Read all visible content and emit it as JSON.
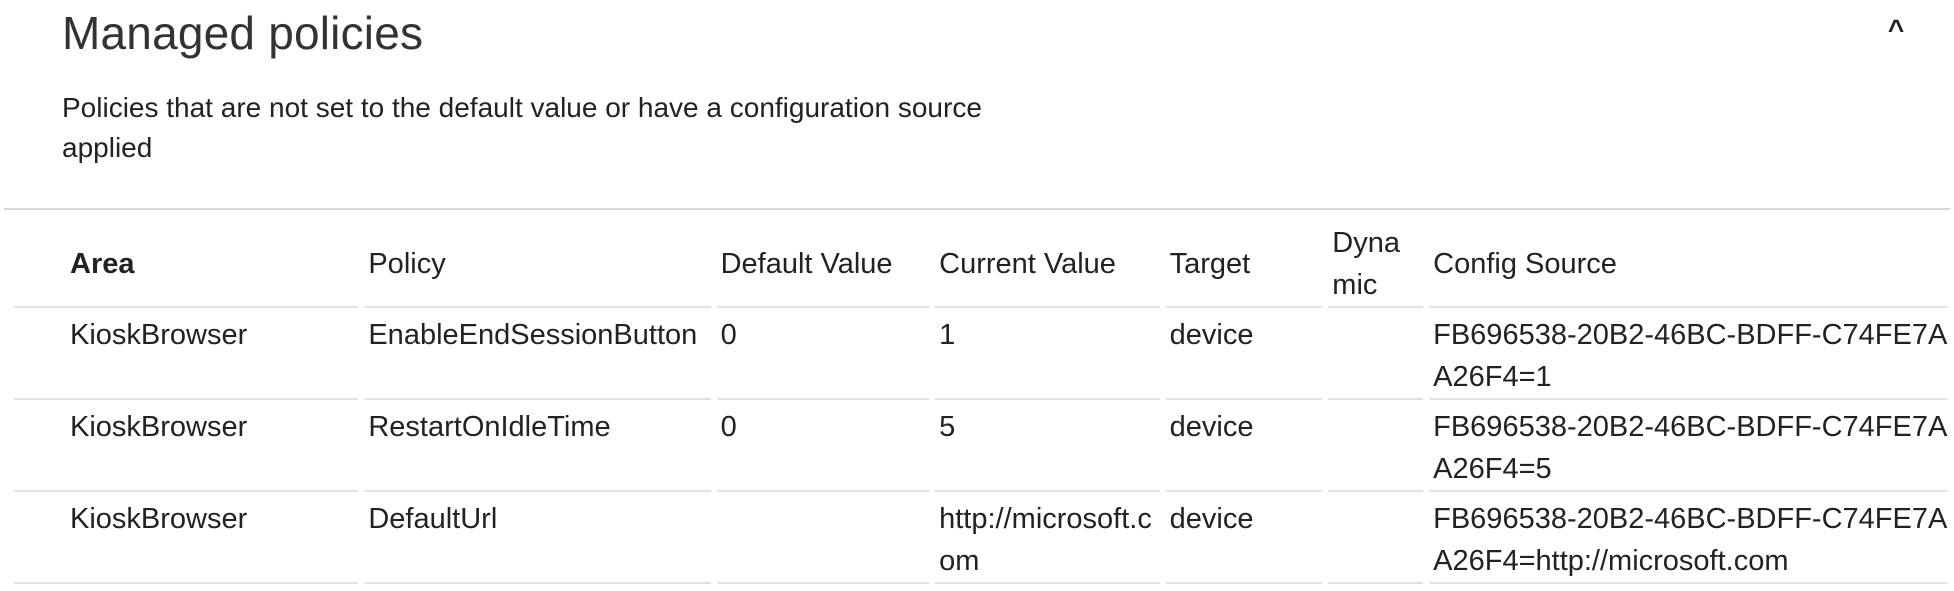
{
  "section": {
    "title": "Managed policies",
    "collapse_glyph": "^",
    "description": "Policies that are not set to the default value or have a configuration source applied"
  },
  "table": {
    "headers": {
      "area": "Area",
      "policy": "Policy",
      "default_value": "Default Value",
      "current_value": "Current Value",
      "target": "Target",
      "dynamic": "Dynamic",
      "config_source": "Config Source"
    },
    "rows": [
      {
        "area": "KioskBrowser",
        "policy": "EnableEndSessionButton",
        "default_value": "0",
        "current_value": "1",
        "target": "device",
        "dynamic": "",
        "config_source": "FB696538-20B2-46BC-BDFF-C74FE7AA26F4=1"
      },
      {
        "area": "KioskBrowser",
        "policy": "RestartOnIdleTime",
        "default_value": "0",
        "current_value": "5",
        "target": "device",
        "dynamic": "",
        "config_source": "FB696538-20B2-46BC-BDFF-C74FE7AA26F4=5"
      },
      {
        "area": "KioskBrowser",
        "policy": "DefaultUrl",
        "default_value": "",
        "current_value": "http://microsoft.com",
        "target": "device",
        "dynamic": "",
        "config_source": "FB696538-20B2-46BC-BDFF-C74FE7AA26F4=http://microsoft.com"
      }
    ]
  }
}
